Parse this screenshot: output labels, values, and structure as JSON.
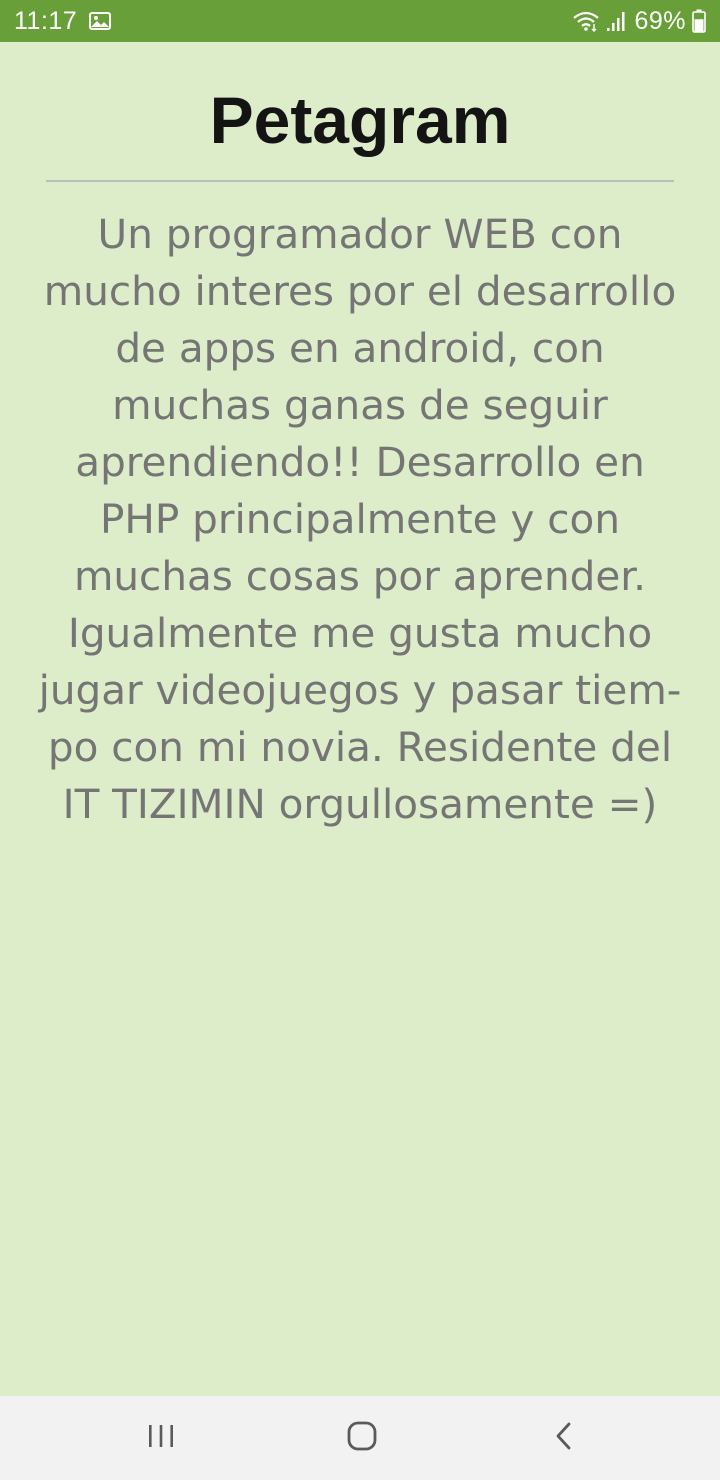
{
  "status_bar": {
    "time": "11:17",
    "battery_percent": "69%",
    "background_color": "#689f38",
    "icons": [
      "image-notification-icon",
      "wifi-icon",
      "signal-icon",
      "battery-icon"
    ],
    "battery_level": 0.69
  },
  "page": {
    "title": "Petagram",
    "bio_lines": [
      "Un programador WEB con",
      "mucho interes por el desarrollo",
      "de apps en android, con",
      "muchas ganas de seguir",
      "aprendiendo!! Desarrollo en",
      "PHP principalmente y con",
      "muchas cosas por aprender.",
      "Igualmente me gusta mucho",
      "jugar videojuegos y pasar tiem-",
      "po con mi novia. Residente del",
      "IT TIZIMIN orgullosamente =)"
    ],
    "background_color": "#ddedc9"
  },
  "nav_bar": {
    "buttons": [
      "recents-icon",
      "home-icon",
      "back-icon"
    ]
  }
}
